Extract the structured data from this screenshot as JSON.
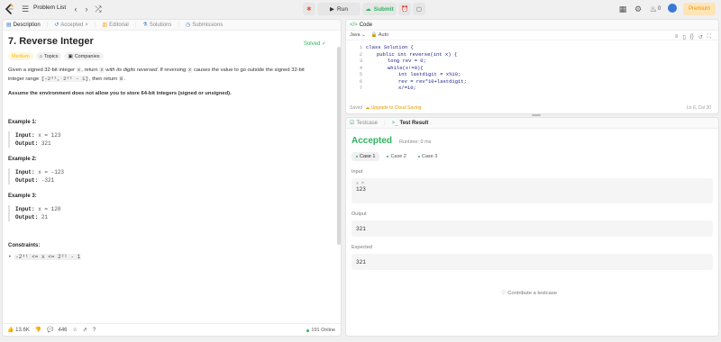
{
  "topbar": {
    "problem_list": "Problem List",
    "run": "Run",
    "submit": "Submit",
    "streak": "0",
    "premium": "Premium"
  },
  "left": {
    "tabs": [
      "Description",
      "Accepted",
      "Editorial",
      "Solutions",
      "Submissions"
    ],
    "title": "7. Reverse Integer",
    "solved": "Solved",
    "chips": [
      "Medium",
      "Topics",
      "Companies"
    ],
    "desc": {
      "a": "Given a signed 32-bit integer ",
      "x1": "x",
      "b": ", return ",
      "x2": "x",
      "c": " with its digits reversed",
      "d": ". If reversing ",
      "x3": "x",
      "e": " causes the value to go outside the signed 32-bit integer range ",
      "range": "[-2³¹, 2³¹ - 1]",
      "f": ", then return ",
      "zero": "0",
      "g": "."
    },
    "assume": "Assume the environment does not allow you to store 64-bit integers (signed or unsigned).",
    "examples": [
      {
        "title": "Example 1:",
        "input": "x = 123",
        "output": "321"
      },
      {
        "title": "Example 2:",
        "input": "x = -123",
        "output": "-321"
      },
      {
        "title": "Example 3:",
        "input": "x = 120",
        "output": "21"
      }
    ],
    "input_label": "Input:",
    "output_label": "Output:",
    "constraints_title": "Constraints:",
    "constraint": "-2³¹ <= x <= 2³¹ - 1",
    "bottom": {
      "likes": "13.6K",
      "comments": "446",
      "online": "191 Online"
    }
  },
  "code": {
    "title": "Code",
    "lang": "Java",
    "auto": "Auto",
    "lines": [
      {
        "n": "1",
        "t": "class Solution {",
        "indent": 0
      },
      {
        "n": "2",
        "t": "public int reverse(int x) {",
        "indent": 1
      },
      {
        "n": "3",
        "t": "long rev = 0;",
        "indent": 2
      },
      {
        "n": "4",
        "t": "while(x!=0){",
        "indent": 2
      },
      {
        "n": "5",
        "t": "int lastdigit = x%10;",
        "indent": 3
      },
      {
        "n": "6",
        "t": "rev = rev*10+lastdigit;",
        "indent": 3
      },
      {
        "n": "7",
        "t": "x/=10;",
        "indent": 3
      }
    ],
    "saved": "Saved",
    "upgrade": "Upgrade to Cloud Saving",
    "lncol": "Ln 6, Col 30"
  },
  "test": {
    "tab1": "Testcase",
    "tab2": "Test Result",
    "status": "Accepted",
    "runtime": "Runtime: 0 ms",
    "cases": [
      "Case 1",
      "Case 2",
      "Case 3"
    ],
    "input_label": "Input",
    "input_var": "x =",
    "input_val": "123",
    "output_label": "Output",
    "output_val": "321",
    "expected_label": "Expected",
    "expected_val": "321",
    "contribute": "Contribute a testcase"
  }
}
